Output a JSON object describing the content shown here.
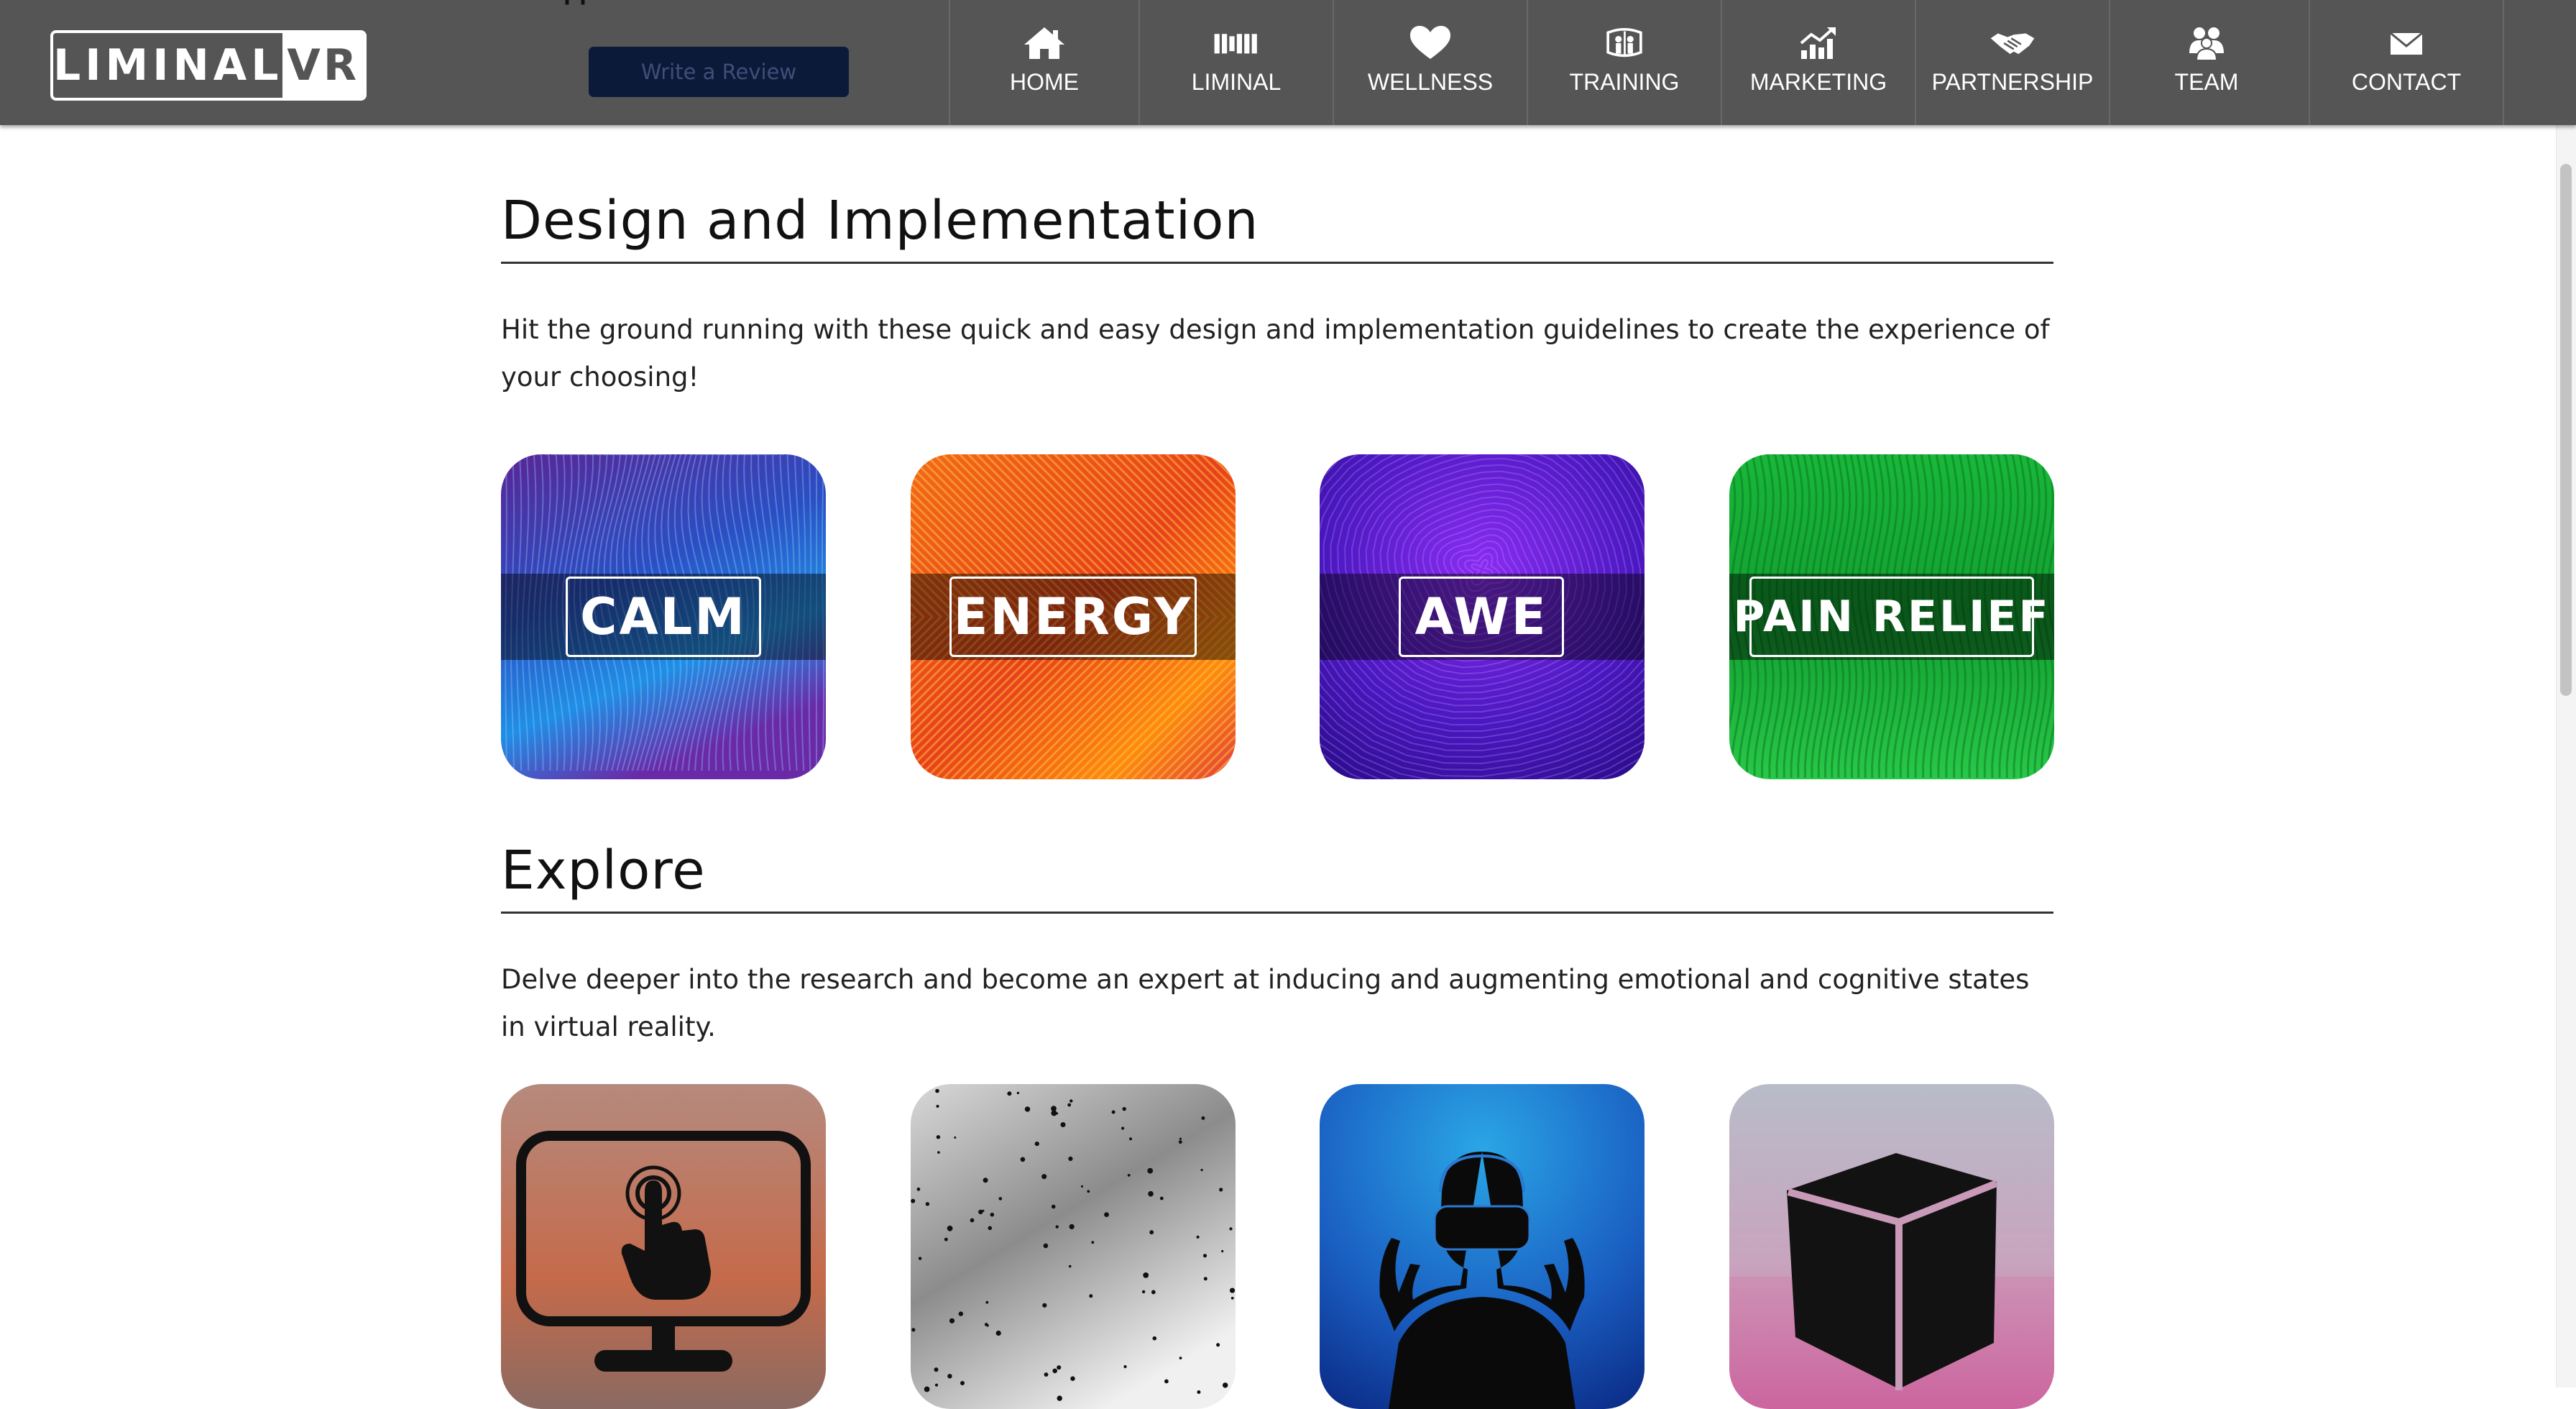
{
  "header": {
    "logo_left": "LIMINAL",
    "logo_right": "VR",
    "cut_off_text": "our app on the Meta store!",
    "review_button": "Write a Review",
    "nav": [
      {
        "label": "HOME",
        "icon": "home-icon"
      },
      {
        "label": "LIMINAL",
        "icon": "liminal-bars-icon"
      },
      {
        "label": "WELLNESS",
        "icon": "heart-icon"
      },
      {
        "label": "TRAINING",
        "icon": "training-icon"
      },
      {
        "label": "MARKETING",
        "icon": "chart-growth-icon"
      },
      {
        "label": "PARTNERSHIP",
        "icon": "handshake-icon"
      },
      {
        "label": "TEAM",
        "icon": "team-icon"
      },
      {
        "label": "CONTACT",
        "icon": "envelope-icon"
      }
    ]
  },
  "design": {
    "title": "Design and Implementation",
    "description": "Hit the ground running with these quick and easy design and implementation guidelines to create the experience of your choosing!",
    "tiles": [
      {
        "label": "CALM",
        "colors": [
          "#5b2a9e",
          "#1f6fd6"
        ]
      },
      {
        "label": "ENERGY",
        "colors": [
          "#f04a1a",
          "#ff9a1a"
        ]
      },
      {
        "label": "AWE",
        "colors": [
          "#3a10a8",
          "#7a2cf0"
        ]
      },
      {
        "label": "PAIN RELIEF",
        "colors": [
          "#10b030",
          "#30d050"
        ]
      }
    ]
  },
  "explore": {
    "title": "Explore",
    "description": "Delve deeper into the research and become an expert at inducing and augmenting emotional and cognitive states in virtual reality.",
    "tiles": [
      {
        "icon": "touchscreen-icon"
      },
      {
        "icon": "particles-icon"
      },
      {
        "icon": "vr-headset-person-icon"
      },
      {
        "icon": "cube-icon"
      }
    ]
  }
}
